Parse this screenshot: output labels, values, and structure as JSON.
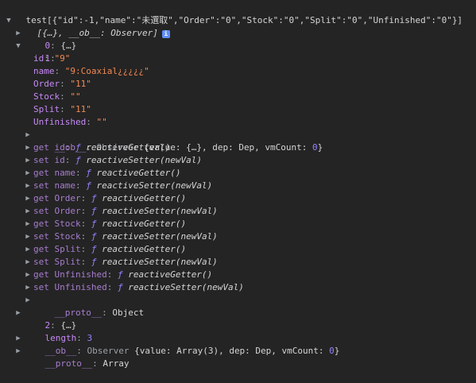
{
  "log_line": "test[{\"id\":-1,\"name\":\"未選取\",\"Order\":\"0\",\"Stock\":\"0\",\"Split\":\"0\",\"Unfinished\":\"0\"}]",
  "array_summary": "[{…}, __ob__: Observer]",
  "info_icon": "i",
  "item0": {
    "key": "0",
    "value": "{…}"
  },
  "item1": {
    "key": "1",
    "props": [
      {
        "key": "id",
        "value": "\"9\""
      },
      {
        "key": "name",
        "value": "\"9:Coaxial¿¿¿¿¿\""
      },
      {
        "key": "Order",
        "value": "\"11\""
      },
      {
        "key": "Stock",
        "value": "\"\""
      },
      {
        "key": "Split",
        "value": "\"11\""
      },
      {
        "key": "Unfinished",
        "value": "\"\""
      }
    ],
    "ob": {
      "key": "__ob__",
      "type": "Observer",
      "body": "{value: {…}, dep: Dep, vmCount: ",
      "count": "0",
      "end": "}"
    },
    "accessors": [
      {
        "key": "get id",
        "fn": "reactiveGetter()"
      },
      {
        "key": "set id",
        "fn": "reactiveSetter(newVal)"
      },
      {
        "key": "get name",
        "fn": "reactiveGetter()"
      },
      {
        "key": "set name",
        "fn": "reactiveSetter(newVal)"
      },
      {
        "key": "get Order",
        "fn": "reactiveGetter()"
      },
      {
        "key": "set Order",
        "fn": "reactiveSetter(newVal)"
      },
      {
        "key": "get Stock",
        "fn": "reactiveGetter()"
      },
      {
        "key": "set Stock",
        "fn": "reactiveSetter(newVal)"
      },
      {
        "key": "get Split",
        "fn": "reactiveGetter()"
      },
      {
        "key": "set Split",
        "fn": "reactiveSetter(newVal)"
      },
      {
        "key": "get Unfinished",
        "fn": "reactiveGetter()"
      },
      {
        "key": "set Unfinished",
        "fn": "reactiveSetter(newVal)"
      }
    ],
    "proto": {
      "key": "__proto__",
      "value": "Object"
    }
  },
  "item2": {
    "key": "2",
    "value": "{…}"
  },
  "length": {
    "key": "length",
    "value": "3"
  },
  "array_ob": {
    "key": "__ob__",
    "type": "Observer",
    "body": "{value: Array(3), dep: Dep, vmCount: ",
    "count": "0",
    "end": "}"
  },
  "array_proto": {
    "key": "__proto__",
    "value": "Array"
  },
  "f_glyph": "ƒ",
  "colors": {
    "background": "#242424",
    "key": "#c589f5",
    "string": "#f28b54",
    "number": "#9980ff",
    "text": "#d5d5d5"
  },
  "icons": {
    "expanded": "triangle-down-icon",
    "collapsed": "triangle-right-icon",
    "info": "info-icon"
  }
}
